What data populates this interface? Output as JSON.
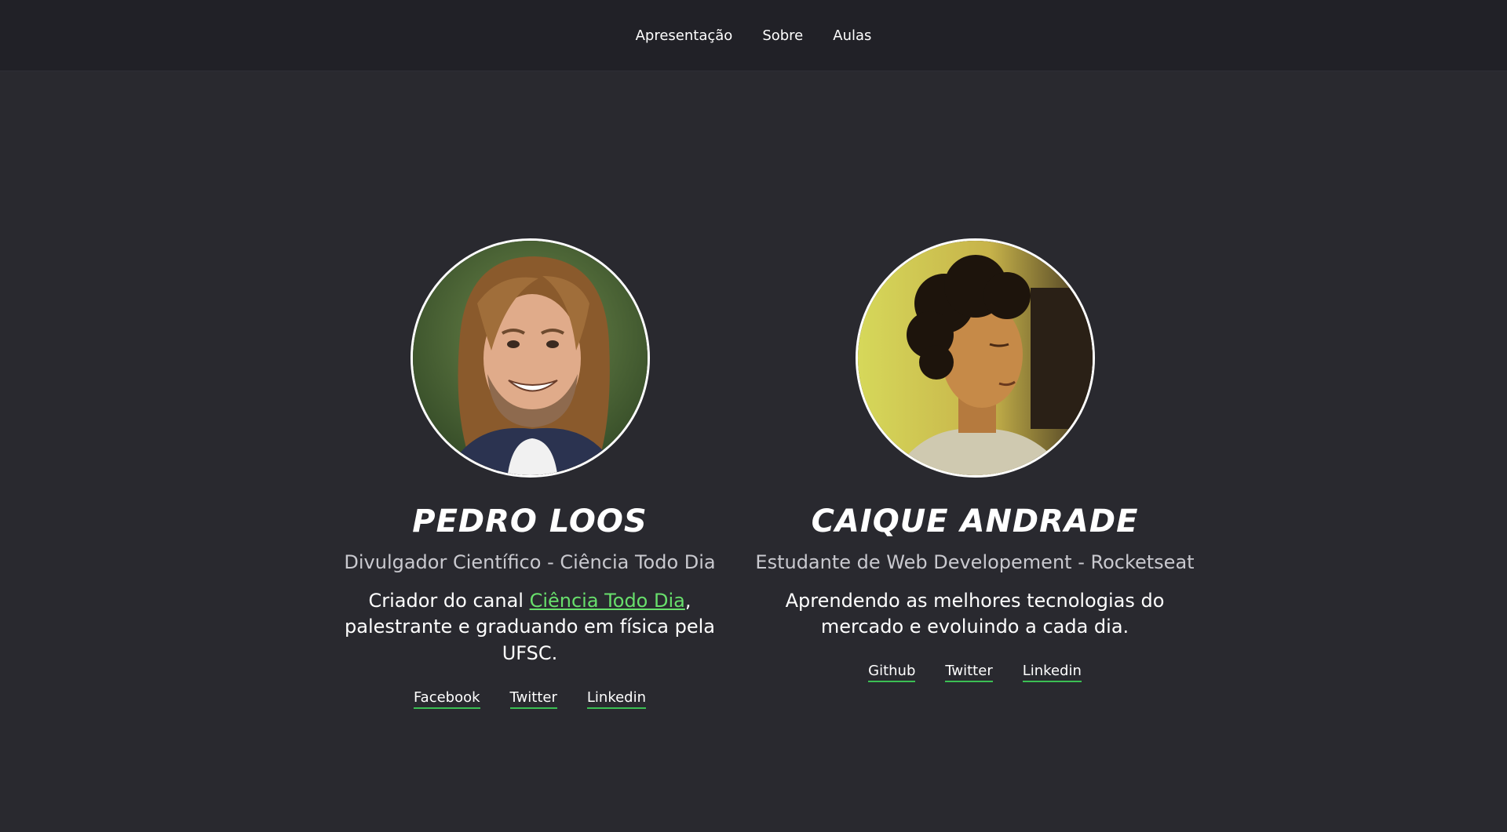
{
  "nav": {
    "items": [
      {
        "label": "Apresentação"
      },
      {
        "label": "Sobre"
      },
      {
        "label": "Aulas"
      }
    ]
  },
  "profiles": [
    {
      "name": "Pedro Loos",
      "role": "Divulgador Científico - Ciência Todo Dia",
      "bio_prefix": "Criador do canal ",
      "bio_link": "Ciência Todo Dia",
      "bio_suffix": ", palestrante e graduando em física pela UFSC.",
      "links": [
        "Facebook",
        "Twitter",
        "Linkedin"
      ]
    },
    {
      "name": "Caique Andrade",
      "role": "Estudante de Web Developement - Rocketseat",
      "bio": "Aprendendo as melhores tecnologias do mercado e evoluindo a cada dia.",
      "links": [
        "Github",
        "Twitter",
        "Linkedin"
      ]
    }
  ],
  "colors": {
    "background": "#29292f",
    "nav_background": "#212127",
    "accent": "#68df6c",
    "text_muted": "#c9c9cf"
  }
}
